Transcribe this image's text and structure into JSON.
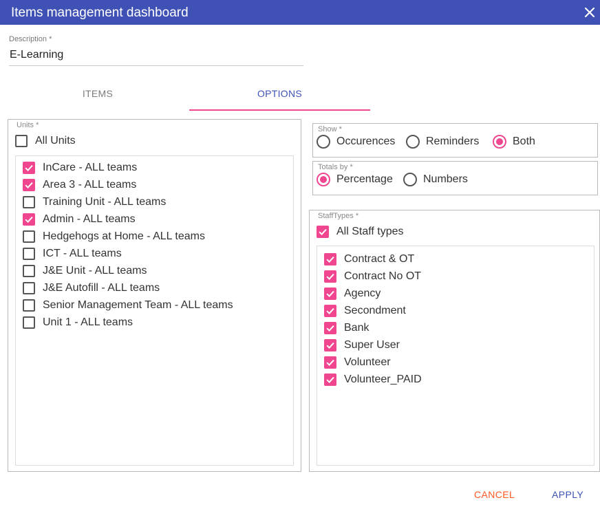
{
  "window": {
    "title": "Items management dashboard"
  },
  "description": {
    "label": "Description *",
    "value": "E-Learning"
  },
  "tabs": [
    {
      "label": "ITEMS",
      "active": false
    },
    {
      "label": "OPTIONS",
      "active": true
    }
  ],
  "units": {
    "legend": "Units *",
    "all": {
      "label": "All Units",
      "checked": false
    },
    "items": [
      {
        "label": "InCare - ALL teams",
        "checked": true
      },
      {
        "label": "Area 3 - ALL teams",
        "checked": true
      },
      {
        "label": "Training Unit - ALL teams",
        "checked": false
      },
      {
        "label": "Admin - ALL teams",
        "checked": true
      },
      {
        "label": "Hedgehogs at Home - ALL teams",
        "checked": false
      },
      {
        "label": "ICT - ALL teams",
        "checked": false
      },
      {
        "label": "J&E Unit - ALL teams",
        "checked": false
      },
      {
        "label": "J&E Autofill - ALL teams",
        "checked": false
      },
      {
        "label": "Senior Management Team - ALL teams",
        "checked": false
      },
      {
        "label": "Unit 1 - ALL teams",
        "checked": false
      }
    ]
  },
  "show": {
    "legend": "Show *",
    "options": [
      {
        "label": "Occurences",
        "selected": false
      },
      {
        "label": "Reminders",
        "selected": false
      },
      {
        "label": "Both",
        "selected": true
      }
    ]
  },
  "totals_by": {
    "legend": "Totals by *",
    "options": [
      {
        "label": "Percentage",
        "selected": true
      },
      {
        "label": "Numbers",
        "selected": false
      }
    ]
  },
  "staff_types": {
    "legend": "StaffTypes *",
    "all": {
      "label": "All Staff types",
      "checked": true
    },
    "items": [
      {
        "label": "Contract & OT",
        "checked": true
      },
      {
        "label": "Contract No OT",
        "checked": true
      },
      {
        "label": "Agency",
        "checked": true
      },
      {
        "label": "Secondment",
        "checked": true
      },
      {
        "label": "Bank",
        "checked": true
      },
      {
        "label": "Super User",
        "checked": true
      },
      {
        "label": "Volunteer",
        "checked": true
      },
      {
        "label": "Volunteer_PAID",
        "checked": true
      }
    ]
  },
  "actions": {
    "cancel": "CANCEL",
    "apply": "APPLY"
  },
  "colors": {
    "primary": "#3f51b5",
    "accent": "#f0468f",
    "warn": "#ff5722"
  },
  "icons": {
    "close": "close-icon",
    "check": "check-icon"
  }
}
